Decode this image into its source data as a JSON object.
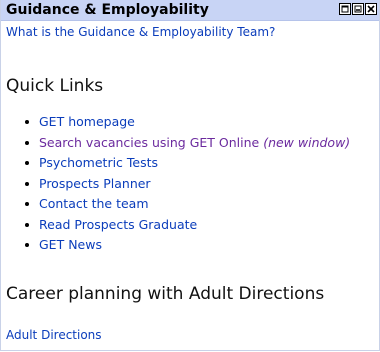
{
  "portlet": {
    "title": "Guidance & Employability",
    "controls": [
      "restore-icon",
      "minimize-icon",
      "close-icon"
    ],
    "team_link": "What is the Guidance & Employability Team?"
  },
  "quick_links": {
    "heading": "Quick Links",
    "items": [
      {
        "label": "GET homepage"
      },
      {
        "label": "Search vacancies using GET Online",
        "note": "(new window)"
      },
      {
        "label": "Psychometric Tests"
      },
      {
        "label": "Prospects Planner"
      },
      {
        "label": "Contact the team"
      },
      {
        "label": "Read Prospects Graduate"
      },
      {
        "label": "GET News"
      }
    ]
  },
  "career": {
    "heading": "Career planning with Adult Directions",
    "link": "Adult Directions"
  },
  "colors": {
    "header_bg": "#c8d4f5",
    "link": "#0b3dbb",
    "visited_link": "#6b2a9e"
  }
}
